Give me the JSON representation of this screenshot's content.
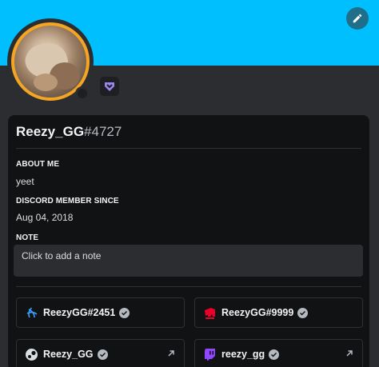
{
  "colors": {
    "banner": "#00bfff",
    "avatar_ring": "#f5a524",
    "card_bg": "#111214",
    "page_bg": "#2b2d31"
  },
  "header": {
    "edit_icon": "pencil-icon",
    "badge_icon": "hypesquad-icon"
  },
  "profile": {
    "username": "Reezy_GG",
    "discriminator": "#4727"
  },
  "about": {
    "title": "ABOUT ME",
    "text": "yeet"
  },
  "member_since": {
    "title": "DISCORD MEMBER SINCE",
    "date": "Aug 04, 2018"
  },
  "note": {
    "title": "NOTE",
    "placeholder": "Click to add a note"
  },
  "connections": [
    {
      "service_icon": "battlenet-icon",
      "name": "ReezyGG#2451"
    },
    {
      "service_icon": "riot-games-icon",
      "name": "ReezyGG#9999"
    },
    {
      "service_icon": "steam-icon",
      "name": "Reezy_GG"
    },
    {
      "service_icon": "twitch-icon",
      "name": "reezy_gg"
    }
  ]
}
